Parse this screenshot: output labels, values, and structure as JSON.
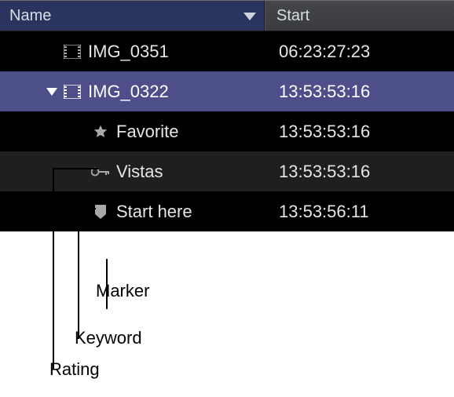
{
  "columns": {
    "name": "Name",
    "start": "Start"
  },
  "rows": [
    {
      "kind": "clip",
      "label": "IMG_0351",
      "start": "06:23:27:23",
      "selected": false,
      "expanded": false,
      "alt": false,
      "indent": 0
    },
    {
      "kind": "clip",
      "label": "IMG_0322",
      "start": "13:53:53:16",
      "selected": true,
      "expanded": true,
      "alt": true,
      "indent": 0
    },
    {
      "kind": "rating",
      "label": "Favorite",
      "start": "13:53:53:16",
      "selected": false,
      "alt": false,
      "indent": 1
    },
    {
      "kind": "keyword",
      "label": "Vistas",
      "start": "13:53:53:16",
      "selected": false,
      "alt": true,
      "indent": 1
    },
    {
      "kind": "marker",
      "label": "Start here",
      "start": "13:53:56:11",
      "selected": false,
      "alt": false,
      "indent": 1
    }
  ],
  "callouts": {
    "marker": "Marker",
    "keyword": "Keyword",
    "rating": "Rating"
  },
  "colors": {
    "selected_row": "#4c4f8a",
    "header_active": "#2b345e"
  }
}
